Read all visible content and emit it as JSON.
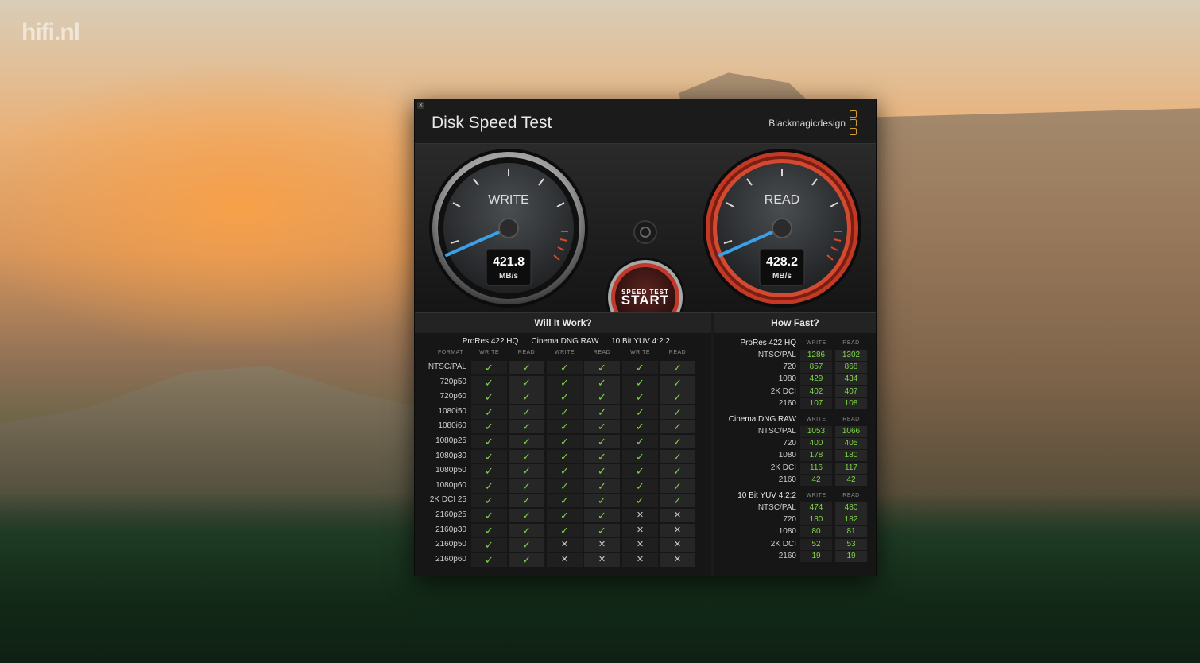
{
  "watermark": "hifi.nl",
  "window": {
    "title": "Disk Speed Test",
    "brand": "Blackmagicdesign",
    "close_glyph": "×"
  },
  "gauges": {
    "write": {
      "label": "WRITE",
      "value": "421.8",
      "unit": "MB/s"
    },
    "read": {
      "label": "READ",
      "value": "428.2",
      "unit": "MB/s"
    },
    "start_small": "SPEED TEST",
    "start_big": "START",
    "settings_icon": "gear-icon"
  },
  "will_it_work": {
    "title": "Will It Work?",
    "format_label": "FORMAT",
    "codecs": [
      "ProRes 422 HQ",
      "Cinema DNG RAW",
      "10 Bit YUV 4:2:2"
    ],
    "sub_labels": [
      "WRITE",
      "READ"
    ],
    "rows": [
      {
        "format": "NTSC/PAL",
        "cells": [
          1,
          1,
          1,
          1,
          1,
          1
        ]
      },
      {
        "format": "720p50",
        "cells": [
          1,
          1,
          1,
          1,
          1,
          1
        ]
      },
      {
        "format": "720p60",
        "cells": [
          1,
          1,
          1,
          1,
          1,
          1
        ]
      },
      {
        "format": "1080i50",
        "cells": [
          1,
          1,
          1,
          1,
          1,
          1
        ]
      },
      {
        "format": "1080i60",
        "cells": [
          1,
          1,
          1,
          1,
          1,
          1
        ]
      },
      {
        "format": "1080p25",
        "cells": [
          1,
          1,
          1,
          1,
          1,
          1
        ]
      },
      {
        "format": "1080p30",
        "cells": [
          1,
          1,
          1,
          1,
          1,
          1
        ]
      },
      {
        "format": "1080p50",
        "cells": [
          1,
          1,
          1,
          1,
          1,
          1
        ]
      },
      {
        "format": "1080p60",
        "cells": [
          1,
          1,
          1,
          1,
          1,
          1
        ]
      },
      {
        "format": "2K DCI 25",
        "cells": [
          1,
          1,
          1,
          1,
          1,
          1
        ]
      },
      {
        "format": "2160p25",
        "cells": [
          1,
          1,
          1,
          1,
          0,
          0
        ]
      },
      {
        "format": "2160p30",
        "cells": [
          1,
          1,
          1,
          1,
          0,
          0
        ]
      },
      {
        "format": "2160p50",
        "cells": [
          1,
          1,
          0,
          0,
          0,
          0
        ]
      },
      {
        "format": "2160p60",
        "cells": [
          1,
          1,
          0,
          0,
          0,
          0
        ]
      }
    ],
    "ok_glyph": "✓",
    "no_glyph": "✕"
  },
  "how_fast": {
    "title": "How Fast?",
    "sub_labels": [
      "WRITE",
      "READ"
    ],
    "groups": [
      {
        "name": "ProRes 422 HQ",
        "rows": [
          {
            "label": "NTSC/PAL",
            "write": "1286",
            "read": "1302"
          },
          {
            "label": "720",
            "write": "857",
            "read": "868"
          },
          {
            "label": "1080",
            "write": "429",
            "read": "434"
          },
          {
            "label": "2K DCI",
            "write": "402",
            "read": "407"
          },
          {
            "label": "2160",
            "write": "107",
            "read": "108"
          }
        ]
      },
      {
        "name": "Cinema DNG RAW",
        "rows": [
          {
            "label": "NTSC/PAL",
            "write": "1053",
            "read": "1066"
          },
          {
            "label": "720",
            "write": "400",
            "read": "405"
          },
          {
            "label": "1080",
            "write": "178",
            "read": "180"
          },
          {
            "label": "2K DCI",
            "write": "116",
            "read": "117"
          },
          {
            "label": "2160",
            "write": "42",
            "read": "42"
          }
        ]
      },
      {
        "name": "10 Bit YUV 4:2:2",
        "rows": [
          {
            "label": "NTSC/PAL",
            "write": "474",
            "read": "480"
          },
          {
            "label": "720",
            "write": "180",
            "read": "182"
          },
          {
            "label": "1080",
            "write": "80",
            "read": "81"
          },
          {
            "label": "2K DCI",
            "write": "52",
            "read": "53"
          },
          {
            "label": "2160",
            "write": "19",
            "read": "19"
          }
        ]
      }
    ]
  },
  "colors": {
    "ok": "#7fd64a",
    "needle": "#3aa0e8",
    "read_ring": "#c23a26",
    "brand_logo": "#d49a2a"
  }
}
